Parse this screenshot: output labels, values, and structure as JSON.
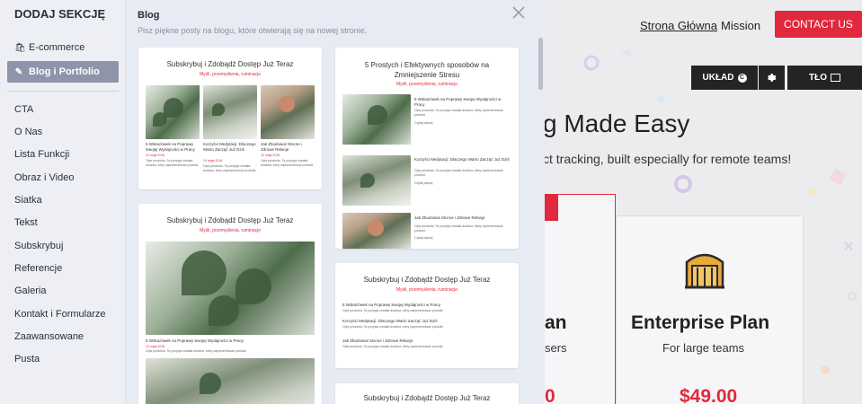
{
  "site": {
    "nav": [
      "Strona Główna",
      "Mission"
    ],
    "contact": "CONTACT US",
    "tools": {
      "layout": "UKŁAD",
      "layout_badge": "C",
      "bg": "TŁO"
    },
    "hero_title": "g Made Easy",
    "hero_sub": "ct tracking, built especially for remote teams!",
    "left_plan_frag": "an",
    "left_sub_frag": "sers",
    "left_price_frag": "0",
    "plan": {
      "name": "Enterprise Plan",
      "desc": "For large teams",
      "price": "$49.00"
    },
    "colors": {
      "accent": "#e0293d",
      "toolbar": "#242424"
    }
  },
  "sidebar": {
    "title": "DODAJ SEKCJĘ",
    "top_items": [
      {
        "label": "E-commerce",
        "icon": "cart-icon"
      },
      {
        "label": "Blog i Portfolio",
        "icon": "edit-icon",
        "selected": true
      }
    ],
    "items": [
      "CTA",
      "O Nas",
      "Lista Funkcji",
      "Obraz i Video",
      "Siatka",
      "Tekst",
      "Subskrybuj",
      "Referencje",
      "Galeria",
      "Kontakt i Formularze",
      "Zaawansowane",
      "Pusta"
    ]
  },
  "panel": {
    "title": "Blog",
    "description": "Pisz piękne posty na blogu, które otwierają się na nowej stronie.",
    "card_heading": "Subskrybuj i Zdobądź Dostęp Już Teraz",
    "card_sub": "Myśli, przemyślenia, ruminacje",
    "card2_heading": "5 Prostych i Efektywnych sposobów na Zmniejszenie Stresu",
    "posts": [
      {
        "title": "5 Wskazówek na Poprawę Swojej Wydajności w Pracy",
        "date": "10 maja 2016",
        "body": "Opis produktu. Ta pozycja została dodana, żeby zaprezentować produkt."
      },
      {
        "title": "Korzyści Medytacji: Dlaczego Warto Zacząć Już Dziś",
        "date": "10 maja 2016",
        "body": "Opis produktu. Ta pozycja została dodana, żeby zaprezentować produkt."
      },
      {
        "title": "Jak Zbudować Mocne i Zdrowe Relacje",
        "date": "10 maja 2016",
        "body": "Opis produktu. Ta pozycja została dodana, żeby zaprezentować produkt."
      }
    ],
    "read_more": "Czytaj więcej"
  }
}
